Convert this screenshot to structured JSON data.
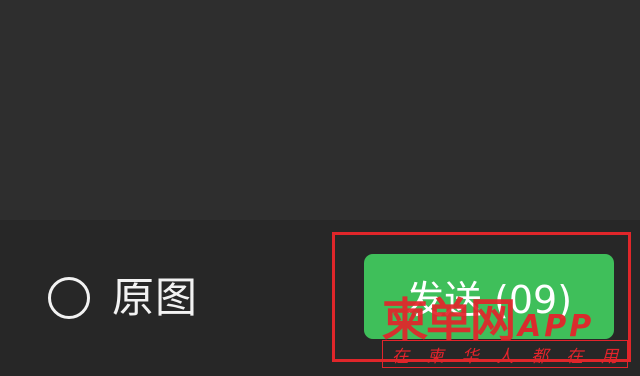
{
  "bottom_bar": {
    "original_image_label": "原图",
    "send_button_label": "发送 (09)"
  },
  "watermark": {
    "brand_text": "柬单网",
    "app_text": "APP",
    "slogan_chars": [
      "在",
      "柬",
      "华",
      "人",
      "都",
      "在",
      "用"
    ]
  },
  "colors": {
    "background": "#2e2e2e",
    "bottom_bar": "#272727",
    "send_button": "#3fbf5a",
    "highlight": "#e0262a"
  }
}
